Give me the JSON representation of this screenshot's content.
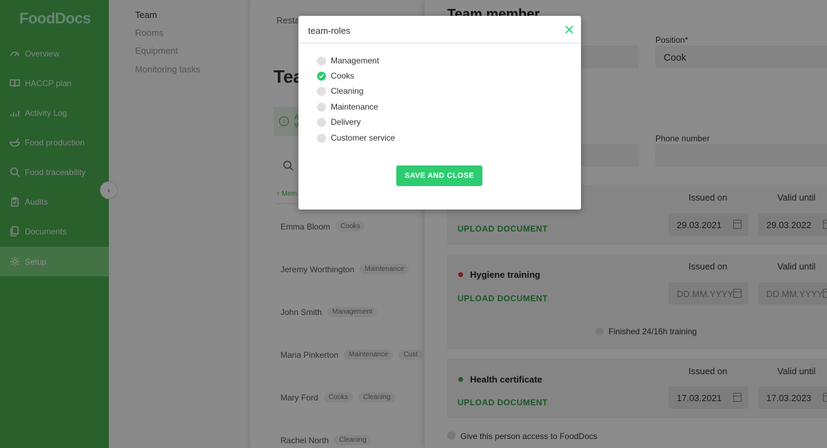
{
  "app": {
    "logo": "FoodDocs"
  },
  "sidebar": {
    "items": [
      {
        "label": "Overview",
        "icon": "gauge-icon"
      },
      {
        "label": "HACCP plan",
        "icon": "book-icon"
      },
      {
        "label": "Activity Log",
        "icon": "bars-icon"
      },
      {
        "label": "Food production",
        "icon": "bowl-icon"
      },
      {
        "label": "Food traceability",
        "icon": "search-icon"
      },
      {
        "label": "Audits",
        "icon": "clipboard-icon"
      },
      {
        "label": "Documents",
        "icon": "documents-icon"
      },
      {
        "label": "Setup",
        "icon": "gear-icon"
      }
    ],
    "active": "Setup"
  },
  "subnav": {
    "items": [
      "Team",
      "Rooms",
      "Equipment",
      "Monitoring tasks"
    ],
    "active": "Team"
  },
  "middle": {
    "tab": "Resta",
    "title": "Tea",
    "info_text_1": "A",
    "info_text_2": "W",
    "sort_label": "Mem",
    "members": [
      {
        "name": "Emma Bloom",
        "tags": [
          "Cooks"
        ]
      },
      {
        "name": "Jeremy Worthington",
        "tags": [
          "Maintenance"
        ]
      },
      {
        "name": "John Smith",
        "tags": [
          "Management"
        ]
      },
      {
        "name": "Maria Pinkerton",
        "tags": [
          "Maintenance",
          "Cust"
        ]
      },
      {
        "name": "Mary Ford",
        "tags": [
          "Cooks",
          "Cleaning"
        ]
      },
      {
        "name": "Rachel North",
        "tags": [
          "Cleaning"
        ]
      }
    ]
  },
  "right_panel": {
    "title": "Team member",
    "position_label": "Position*",
    "position_value": "Cook",
    "phone_label": "Phone number",
    "issued_label": "Issued on",
    "valid_label": "Valid until",
    "upload_label": "UPLOAD DOCUMENT",
    "documents": [
      {
        "name": "",
        "status_color": "",
        "issued": "29.03.2021",
        "valid": "29.03.2022"
      },
      {
        "name": "Hygiene training",
        "status_color": "#e53935",
        "issued": "DD.MM.YYYY",
        "valid": "DD.MM.YYYY"
      },
      {
        "name": "Health certificate",
        "status_color": "#43a047",
        "issued": "17.03.2021",
        "valid": "17.03.2023"
      }
    ],
    "finished_training_label": "Finished 24/16h training",
    "access_label": "Give this person access to FoodDocs"
  },
  "modal": {
    "title": "team-roles",
    "roles": [
      {
        "label": "Management",
        "checked": false
      },
      {
        "label": "Cooks",
        "checked": true
      },
      {
        "label": "Cleaning",
        "checked": false
      },
      {
        "label": "Maintenance",
        "checked": false
      },
      {
        "label": "Delivery",
        "checked": false
      },
      {
        "label": "Customer service",
        "checked": false
      }
    ],
    "save_label": "SAVE AND CLOSE"
  },
  "colors": {
    "brand_green": "#4caf50",
    "accent_green": "#2ecc71",
    "overlay": "rgba(0,0,0,0.45)"
  }
}
